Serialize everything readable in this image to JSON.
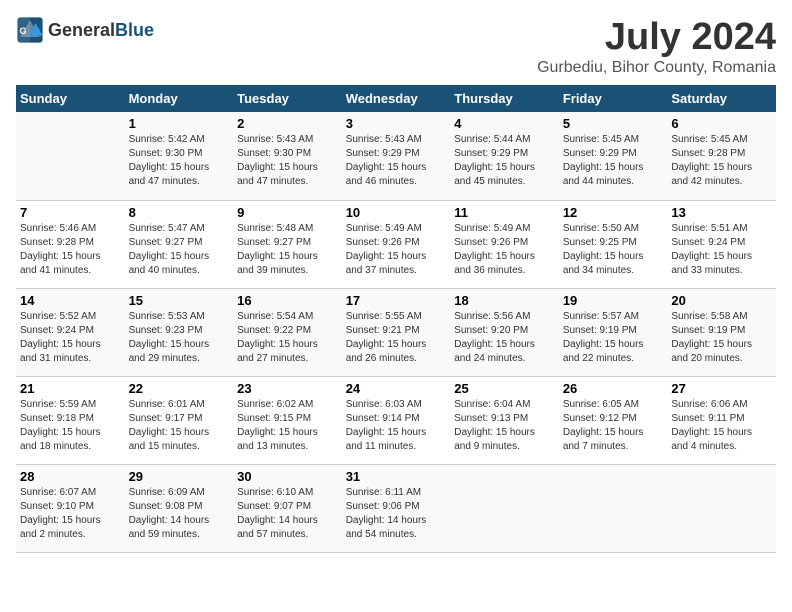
{
  "header": {
    "logo_general": "General",
    "logo_blue": "Blue",
    "title": "July 2024",
    "subtitle": "Gurbediu, Bihor County, Romania"
  },
  "weekdays": [
    "Sunday",
    "Monday",
    "Tuesday",
    "Wednesday",
    "Thursday",
    "Friday",
    "Saturday"
  ],
  "weeks": [
    [
      {
        "day": "",
        "info": ""
      },
      {
        "day": "1",
        "info": "Sunrise: 5:42 AM\nSunset: 9:30 PM\nDaylight: 15 hours\nand 47 minutes."
      },
      {
        "day": "2",
        "info": "Sunrise: 5:43 AM\nSunset: 9:30 PM\nDaylight: 15 hours\nand 47 minutes."
      },
      {
        "day": "3",
        "info": "Sunrise: 5:43 AM\nSunset: 9:29 PM\nDaylight: 15 hours\nand 46 minutes."
      },
      {
        "day": "4",
        "info": "Sunrise: 5:44 AM\nSunset: 9:29 PM\nDaylight: 15 hours\nand 45 minutes."
      },
      {
        "day": "5",
        "info": "Sunrise: 5:45 AM\nSunset: 9:29 PM\nDaylight: 15 hours\nand 44 minutes."
      },
      {
        "day": "6",
        "info": "Sunrise: 5:45 AM\nSunset: 9:28 PM\nDaylight: 15 hours\nand 42 minutes."
      }
    ],
    [
      {
        "day": "7",
        "info": "Sunrise: 5:46 AM\nSunset: 9:28 PM\nDaylight: 15 hours\nand 41 minutes."
      },
      {
        "day": "8",
        "info": "Sunrise: 5:47 AM\nSunset: 9:27 PM\nDaylight: 15 hours\nand 40 minutes."
      },
      {
        "day": "9",
        "info": "Sunrise: 5:48 AM\nSunset: 9:27 PM\nDaylight: 15 hours\nand 39 minutes."
      },
      {
        "day": "10",
        "info": "Sunrise: 5:49 AM\nSunset: 9:26 PM\nDaylight: 15 hours\nand 37 minutes."
      },
      {
        "day": "11",
        "info": "Sunrise: 5:49 AM\nSunset: 9:26 PM\nDaylight: 15 hours\nand 36 minutes."
      },
      {
        "day": "12",
        "info": "Sunrise: 5:50 AM\nSunset: 9:25 PM\nDaylight: 15 hours\nand 34 minutes."
      },
      {
        "day": "13",
        "info": "Sunrise: 5:51 AM\nSunset: 9:24 PM\nDaylight: 15 hours\nand 33 minutes."
      }
    ],
    [
      {
        "day": "14",
        "info": "Sunrise: 5:52 AM\nSunset: 9:24 PM\nDaylight: 15 hours\nand 31 minutes."
      },
      {
        "day": "15",
        "info": "Sunrise: 5:53 AM\nSunset: 9:23 PM\nDaylight: 15 hours\nand 29 minutes."
      },
      {
        "day": "16",
        "info": "Sunrise: 5:54 AM\nSunset: 9:22 PM\nDaylight: 15 hours\nand 27 minutes."
      },
      {
        "day": "17",
        "info": "Sunrise: 5:55 AM\nSunset: 9:21 PM\nDaylight: 15 hours\nand 26 minutes."
      },
      {
        "day": "18",
        "info": "Sunrise: 5:56 AM\nSunset: 9:20 PM\nDaylight: 15 hours\nand 24 minutes."
      },
      {
        "day": "19",
        "info": "Sunrise: 5:57 AM\nSunset: 9:19 PM\nDaylight: 15 hours\nand 22 minutes."
      },
      {
        "day": "20",
        "info": "Sunrise: 5:58 AM\nSunset: 9:19 PM\nDaylight: 15 hours\nand 20 minutes."
      }
    ],
    [
      {
        "day": "21",
        "info": "Sunrise: 5:59 AM\nSunset: 9:18 PM\nDaylight: 15 hours\nand 18 minutes."
      },
      {
        "day": "22",
        "info": "Sunrise: 6:01 AM\nSunset: 9:17 PM\nDaylight: 15 hours\nand 15 minutes."
      },
      {
        "day": "23",
        "info": "Sunrise: 6:02 AM\nSunset: 9:15 PM\nDaylight: 15 hours\nand 13 minutes."
      },
      {
        "day": "24",
        "info": "Sunrise: 6:03 AM\nSunset: 9:14 PM\nDaylight: 15 hours\nand 11 minutes."
      },
      {
        "day": "25",
        "info": "Sunrise: 6:04 AM\nSunset: 9:13 PM\nDaylight: 15 hours\nand 9 minutes."
      },
      {
        "day": "26",
        "info": "Sunrise: 6:05 AM\nSunset: 9:12 PM\nDaylight: 15 hours\nand 7 minutes."
      },
      {
        "day": "27",
        "info": "Sunrise: 6:06 AM\nSunset: 9:11 PM\nDaylight: 15 hours\nand 4 minutes."
      }
    ],
    [
      {
        "day": "28",
        "info": "Sunrise: 6:07 AM\nSunset: 9:10 PM\nDaylight: 15 hours\nand 2 minutes."
      },
      {
        "day": "29",
        "info": "Sunrise: 6:09 AM\nSunset: 9:08 PM\nDaylight: 14 hours\nand 59 minutes."
      },
      {
        "day": "30",
        "info": "Sunrise: 6:10 AM\nSunset: 9:07 PM\nDaylight: 14 hours\nand 57 minutes."
      },
      {
        "day": "31",
        "info": "Sunrise: 6:11 AM\nSunset: 9:06 PM\nDaylight: 14 hours\nand 54 minutes."
      },
      {
        "day": "",
        "info": ""
      },
      {
        "day": "",
        "info": ""
      },
      {
        "day": "",
        "info": ""
      }
    ]
  ]
}
